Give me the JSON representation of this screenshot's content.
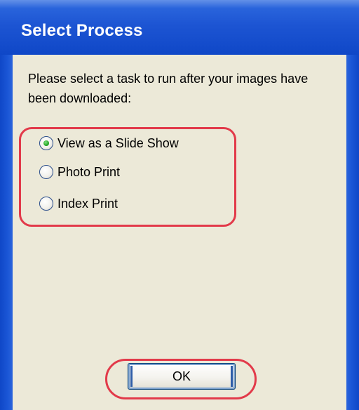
{
  "window": {
    "title": "Select Process"
  },
  "dialog": {
    "instruction": "Please select a task to run after your images have been downloaded:",
    "options": [
      {
        "label": "View as a Slide Show",
        "selected": true
      },
      {
        "label": "Photo Print",
        "selected": false
      },
      {
        "label": "Index Print",
        "selected": false
      }
    ],
    "ok_label": "OK"
  },
  "colors": {
    "titlebar": "#1d55d3",
    "dialog_background": "#ece9d8",
    "highlight_ring": "#e23a4a",
    "selected_dot": "#23a623"
  }
}
